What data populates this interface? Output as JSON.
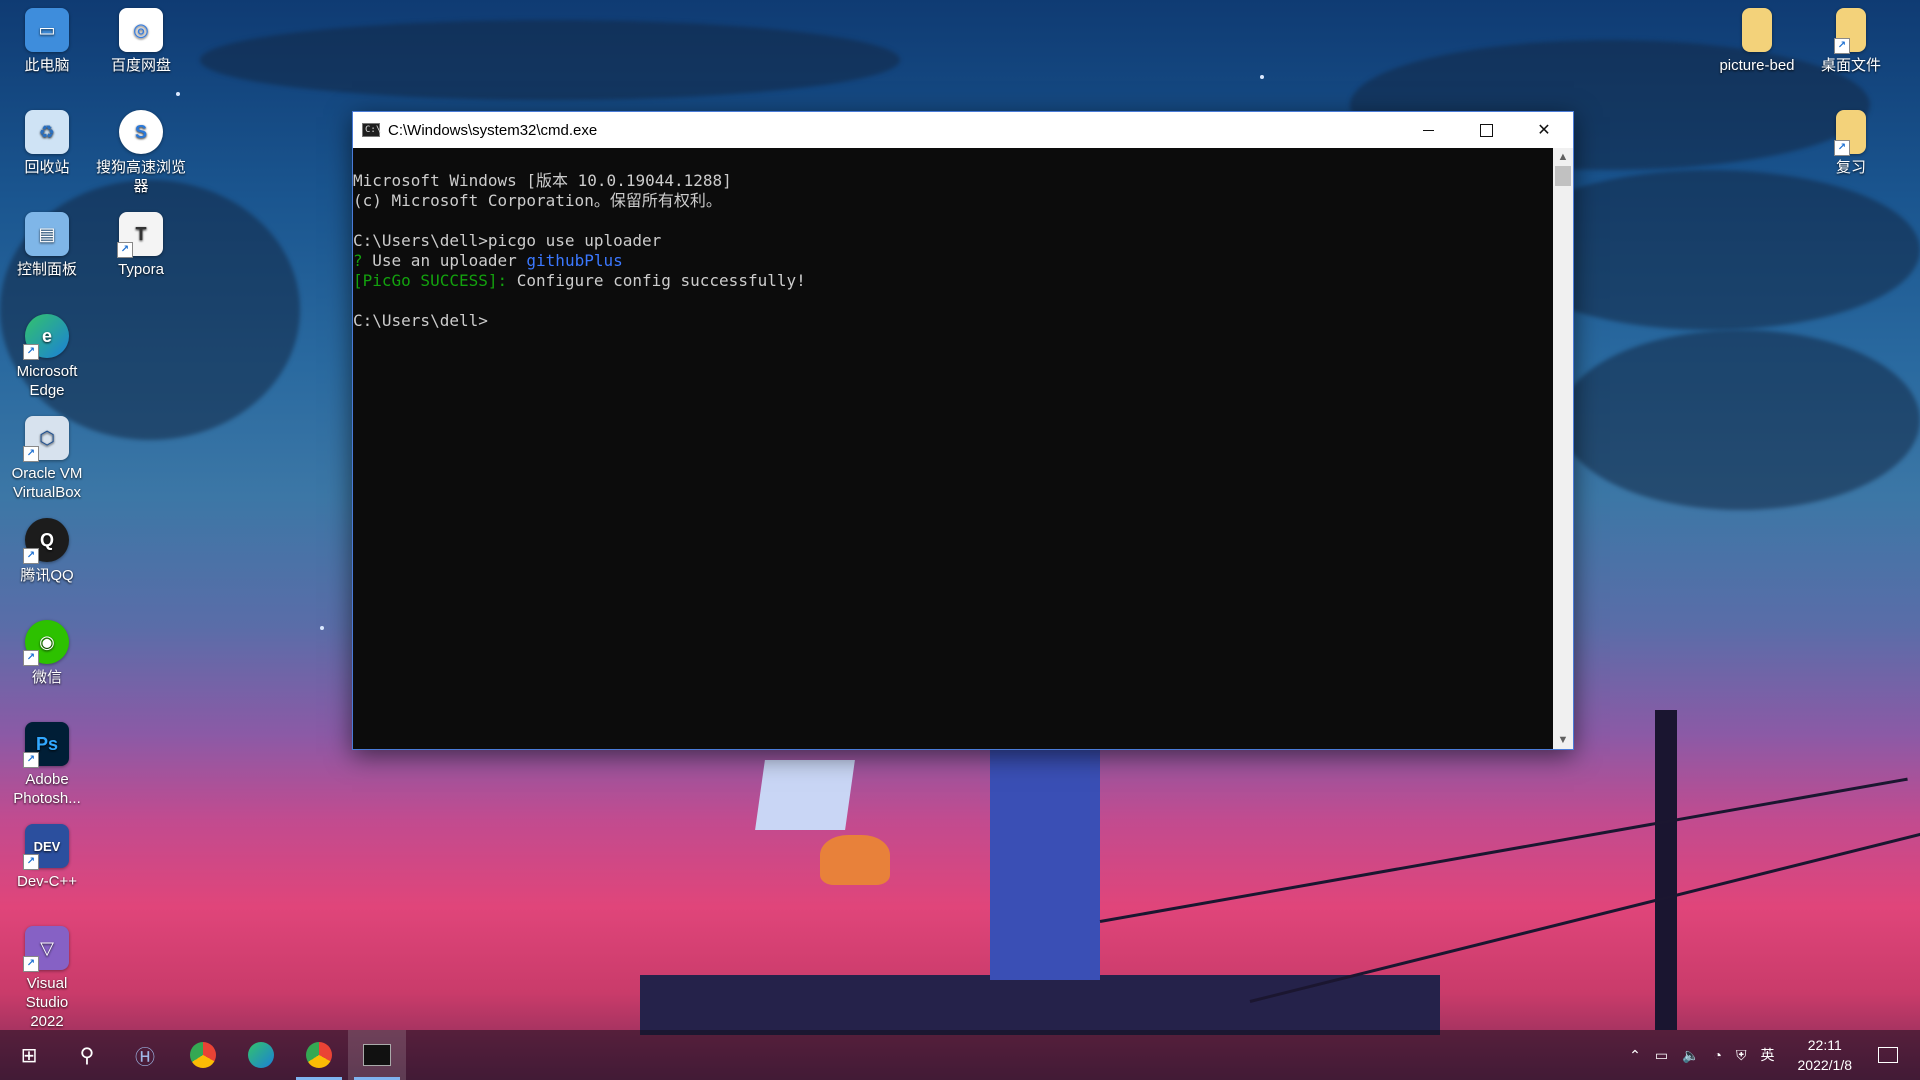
{
  "desktop": {
    "left_icons": [
      {
        "label": "此电脑",
        "icon": "computer-icon"
      },
      {
        "label": "百度网盘",
        "icon": "baidu-netdisk-icon"
      },
      {
        "label": "回收站",
        "icon": "recycle-bin-icon"
      },
      {
        "label": "搜狗高速浏览器",
        "icon": "sogou-browser-icon"
      },
      {
        "label": "控制面板",
        "icon": "control-panel-icon"
      },
      {
        "label": "Typora",
        "icon": "typora-icon"
      },
      {
        "label": "Microsoft Edge",
        "icon": "edge-icon"
      },
      {
        "label": "Oracle VM VirtualBox",
        "icon": "virtualbox-icon"
      },
      {
        "label": "腾讯QQ",
        "icon": "qq-icon"
      },
      {
        "label": "微信",
        "icon": "wechat-icon"
      },
      {
        "label": "Adobe Photosh...",
        "icon": "photoshop-icon"
      },
      {
        "label": "Dev-C++",
        "icon": "devcpp-icon"
      },
      {
        "label": "Visual Studio 2022",
        "icon": "visual-studio-icon"
      }
    ],
    "right_icons": [
      {
        "label": "picture-bed",
        "icon": "folder-icon"
      },
      {
        "label": "桌面文件",
        "icon": "folder-icon"
      },
      {
        "label": "复习",
        "icon": "folder-icon"
      }
    ]
  },
  "window": {
    "title": "C:\\Windows\\system32\\cmd.exe",
    "controls": {
      "minimize": "minimize",
      "maximize": "maximize",
      "close": "close"
    }
  },
  "console": {
    "line1": "Microsoft Windows [版本 10.0.19044.1288]",
    "line2": "(c) Microsoft Corporation。保留所有权利。",
    "line3": "",
    "prompt1": "C:\\Users\\dell>",
    "command1": "picgo use uploader",
    "q_mark": "?",
    "q_text": " Use an uploader ",
    "q_answer": "githubPlus",
    "success_tag": "[PicGo SUCCESS]:",
    "success_text": " Configure config successfully!",
    "line7": "",
    "prompt2": "C:\\Users\\dell>"
  },
  "taskbar": {
    "apps": [
      "start-icon",
      "search-icon",
      "app-h-icon",
      "chrome-icon",
      "edge-icon",
      "chrome-icon",
      "cmd-icon"
    ],
    "tray": {
      "ime": "英",
      "time": "22:11",
      "date": "2022/1/8"
    }
  }
}
